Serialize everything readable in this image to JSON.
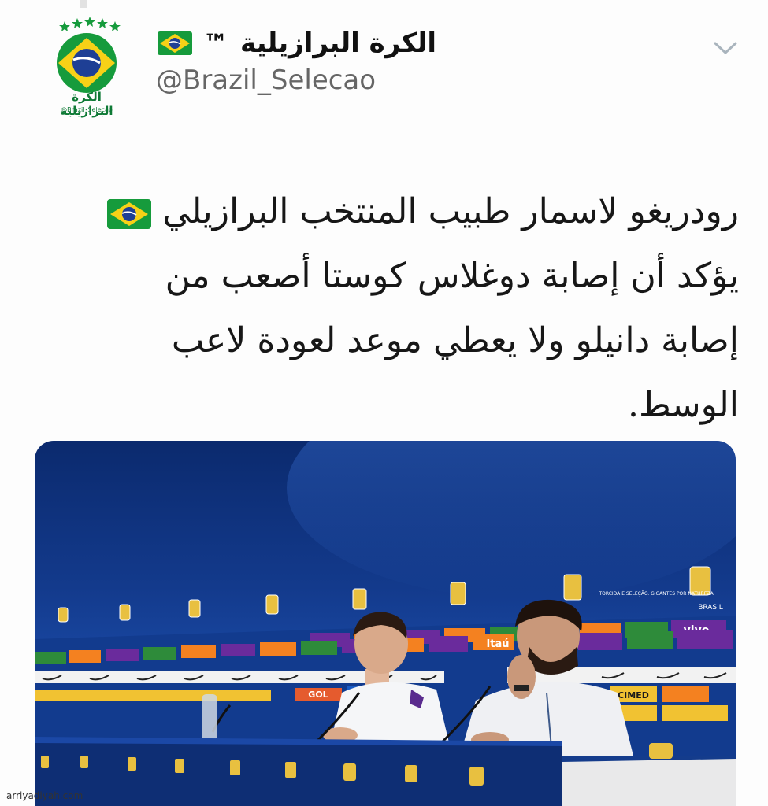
{
  "account": {
    "display_name": "الكرة البرازيلية",
    "tm": "™",
    "handle": "@Brazil_Selecao",
    "avatar_brand_text": "الكرة البرازيلية",
    "avatar_brand_handle": "@Brazil_Selecao"
  },
  "tweet": {
    "lines": [
      "رودريغو لاسمار طبيب المنتخب البرازيلي",
      "يؤكد أن إصابة دوغلاس كوستا أصعب من",
      "إصابة دانيلو ولا يعطي موعد لعودة لاعب",
      "الوسط."
    ]
  },
  "photo": {
    "sponsor_vivo": "vivo",
    "sponsor_itau": "Itaú",
    "sponsor_cimed": "CIMED",
    "sponsor_gol": "GOL",
    "brasil_label": "BRASIL",
    "slogan": "TORCIDA E SELEÇÃO. GIGANTES POR NATUREZA."
  },
  "watermark": "arriyadiyah.com",
  "colors": {
    "flag_green": "#169b3c",
    "flag_yellow": "#f7d117",
    "flag_blue": "#1e3f95",
    "backdrop_blue": "#133a8c",
    "handle_gray": "#666666"
  },
  "icons": {
    "chevron": "chevron-down-icon",
    "flag": "brazil-flag-icon"
  }
}
